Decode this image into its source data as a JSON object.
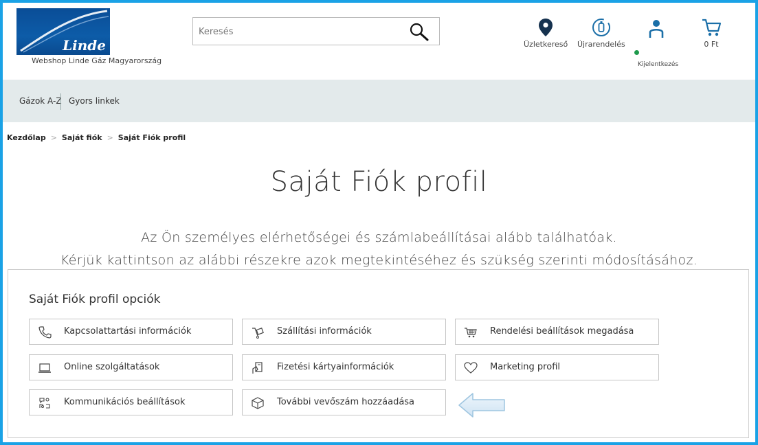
{
  "header": {
    "logo_text": "Linde",
    "shop_name": "Webshop Linde Gáz Magyarország",
    "search": {
      "placeholder": "Keresés",
      "value": ""
    },
    "items": {
      "store_finder": "Üzletkereső",
      "reorder": "Újrarendelés",
      "logout": "Kijelentkezés",
      "cart_total": "0 Ft"
    },
    "status_color": "#1e9a4c"
  },
  "nav": {
    "items": [
      "Gázok A-Z",
      "Gyors linkek"
    ]
  },
  "breadcrumb": {
    "items": [
      "Kezdőlap",
      "Saját fiók",
      "Saját Fiók profil"
    ],
    "separator": ">"
  },
  "main": {
    "title": "Saját Fiók profil",
    "intro_line1": "Az Ön személyes elérhetőségei és számlabeállításai alább találhatóak.",
    "intro_line2": "Kérjük kattintson az alábbi részekre azok megtekintéséhez és szükség szerinti módosításához.",
    "panel_title": "Saját Fiók profil opciók",
    "options": [
      {
        "label": "Kapcsolattartási információk",
        "icon": "phone-icon"
      },
      {
        "label": "Szállítási információk",
        "icon": "delivery-icon"
      },
      {
        "label": "Rendelési beállítások megadása",
        "icon": "cart-icon"
      },
      {
        "label": "Online szolgáltatások",
        "icon": "laptop-icon"
      },
      {
        "label": "Fizetési kártyainformációk",
        "icon": "card-icon"
      },
      {
        "label": "Marketing profil",
        "icon": "heart-icon"
      },
      {
        "label": "Kommunikációs beállítások",
        "icon": "communication-icon"
      },
      {
        "label": "További vevőszám hozzáadása",
        "icon": "box-icon"
      }
    ]
  },
  "colors": {
    "frame": "#1aa2e6",
    "brand_blue": "#0a4d97",
    "nav_bg": "#e3eaeb",
    "arrow_fill": "#dcecf7",
    "arrow_stroke": "#9ec5e0"
  }
}
